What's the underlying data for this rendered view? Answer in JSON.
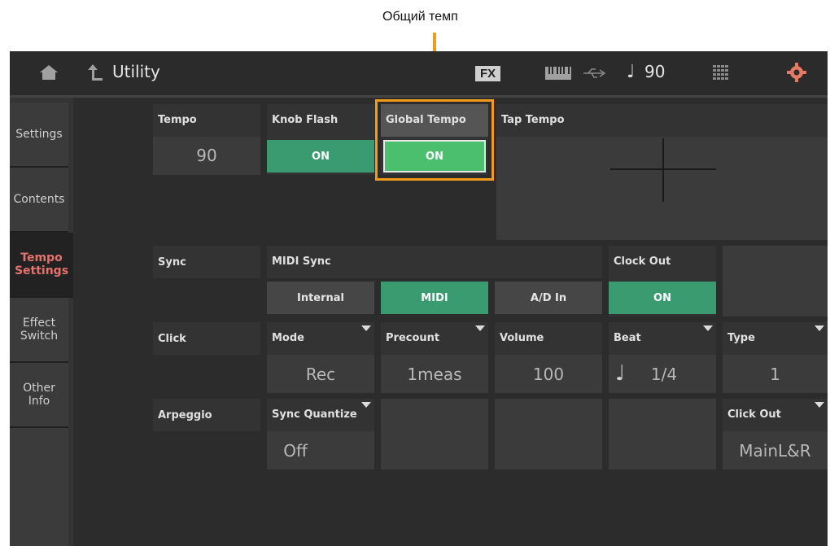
{
  "callout": {
    "text": "Общий темп"
  },
  "header": {
    "title": "Utility",
    "fx": "FX",
    "tempo": "90"
  },
  "sidebar": {
    "items": [
      {
        "label": "Settings"
      },
      {
        "label": "Contents"
      },
      {
        "label": "Tempo\nSettings",
        "active": true
      },
      {
        "label": "Effect\nSwitch"
      },
      {
        "label": "Other\nInfo"
      }
    ]
  },
  "tempo": {
    "label": "Tempo",
    "value": "90"
  },
  "knob_flash": {
    "label": "Knob Flash",
    "value": "ON"
  },
  "global_tempo": {
    "label": "Global Tempo",
    "value": "ON"
  },
  "tap_tempo": {
    "label": "Tap Tempo"
  },
  "sync": {
    "label": "Sync",
    "midi_sync": {
      "label": "MIDI Sync",
      "options": [
        "Internal",
        "MIDI",
        "A/D In"
      ],
      "selected": "MIDI"
    },
    "clock_out": {
      "label": "Clock Out",
      "value": "ON"
    }
  },
  "click": {
    "label": "Click",
    "mode": {
      "label": "Mode",
      "value": "Rec"
    },
    "precount": {
      "label": "Precount",
      "value": "1meas"
    },
    "volume": {
      "label": "Volume",
      "value": "100"
    },
    "beat": {
      "label": "Beat",
      "value": "1/4"
    },
    "type": {
      "label": "Type",
      "value": "1"
    }
  },
  "arpeggio": {
    "label": "Arpeggio",
    "sync_quantize": {
      "label": "Sync Quantize",
      "value": "Off"
    },
    "click_out": {
      "label": "Click Out",
      "value": "MainL&R"
    }
  },
  "colors": {
    "accent": "#f39a1b",
    "on": "#3a9a70",
    "active_tab": "#e3736c"
  }
}
